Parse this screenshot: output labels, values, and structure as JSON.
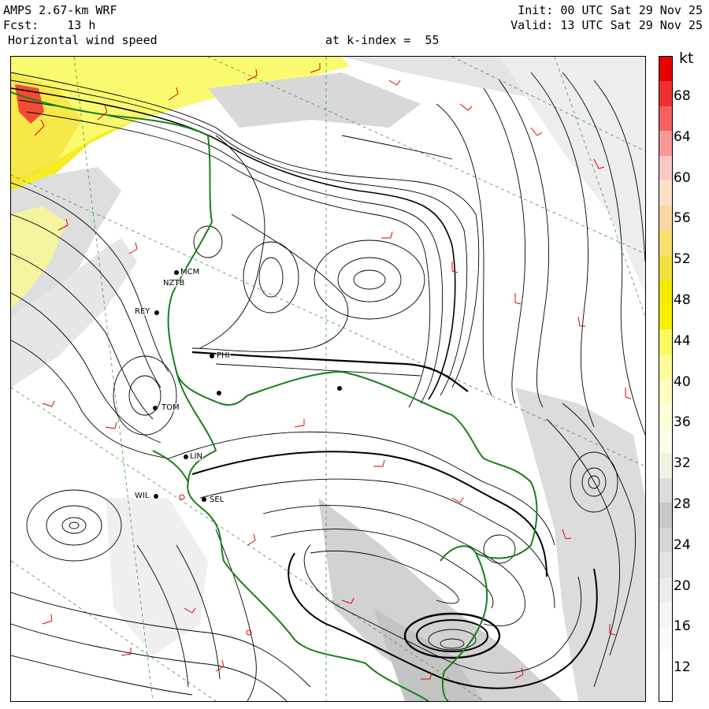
{
  "header": {
    "model": "AMPS 2.67-km WRF",
    "fcst": "Fcst:    13 h",
    "field": "Horizontal wind speed",
    "level": "at k-index =  55",
    "init": "Init: 00 UTC Sat 29 Nov 25",
    "valid": "Valid: 13 UTC Sat 29 Nov 25"
  },
  "colorbar": {
    "unit": "kt",
    "ticks": [
      "68",
      "64",
      "60",
      "56",
      "52",
      "48",
      "44",
      "40",
      "36",
      "32",
      "28",
      "24",
      "20",
      "16",
      "12"
    ],
    "segments": [
      "#e60000",
      "#f03030",
      "#f46060",
      "#f79898",
      "#fac8c8",
      "#fbe0c8",
      "#f8d8a0",
      "#f5e070",
      "#f2e040",
      "#f2ea00",
      "#f8f000",
      "#fafa60",
      "#fcfc98",
      "#fdfdc0",
      "#fefed8",
      "#fdfde8",
      "#f2f2e2",
      "#dcdcdc",
      "#c8c8c8",
      "#d6d6d6",
      "#e2e2e2",
      "#ececec",
      "#f4f4f4",
      "#fafafa",
      "#ffffff",
      "#ffffff"
    ]
  },
  "stations": [
    {
      "id": "st-mcm",
      "label": "MCM"
    },
    {
      "id": "st-nztb",
      "label": "NZTB"
    },
    {
      "id": "st-rey",
      "label": "REY"
    },
    {
      "id": "st-tom",
      "label": "TOM"
    },
    {
      "id": "st-lin",
      "label": "LIN"
    },
    {
      "id": "st-wil",
      "label": "WIL"
    },
    {
      "id": "st-sel",
      "label": "SEL"
    },
    {
      "id": "st-phi",
      "label": "PHI"
    }
  ],
  "colors": {
    "coast": "#1a7f1a",
    "grid": "#3a9a3a",
    "barb": "#e00000",
    "stream": "#000000"
  }
}
